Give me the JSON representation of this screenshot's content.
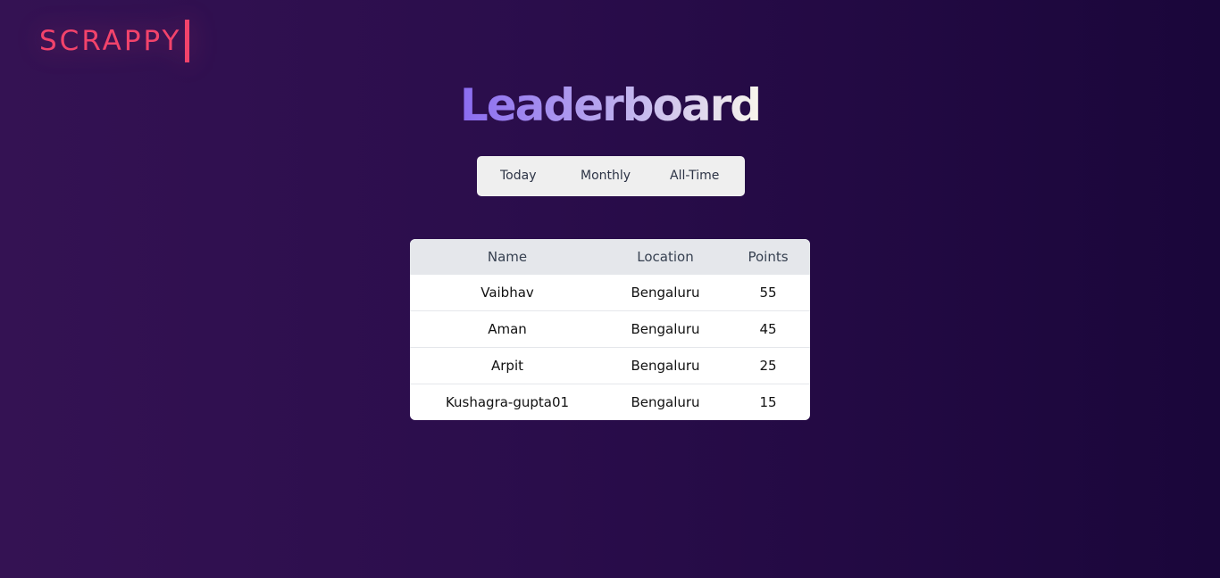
{
  "brand": {
    "logo_text": "SCRAPPY",
    "accent_color": "#f2436b"
  },
  "page": {
    "title": "Leaderboard"
  },
  "tabs": [
    {
      "label": "Today"
    },
    {
      "label": "Monthly"
    },
    {
      "label": "All-Time"
    }
  ],
  "table": {
    "columns": [
      "Name",
      "Location",
      "Points"
    ],
    "rows": [
      {
        "name": "Vaibhav",
        "location": "Bengaluru",
        "points": "55"
      },
      {
        "name": "Aman",
        "location": "Bengaluru",
        "points": "45"
      },
      {
        "name": "Arpit",
        "location": "Bengaluru",
        "points": "25"
      },
      {
        "name": "Kushagra-gupta01",
        "location": "Bengaluru",
        "points": "15"
      }
    ]
  }
}
